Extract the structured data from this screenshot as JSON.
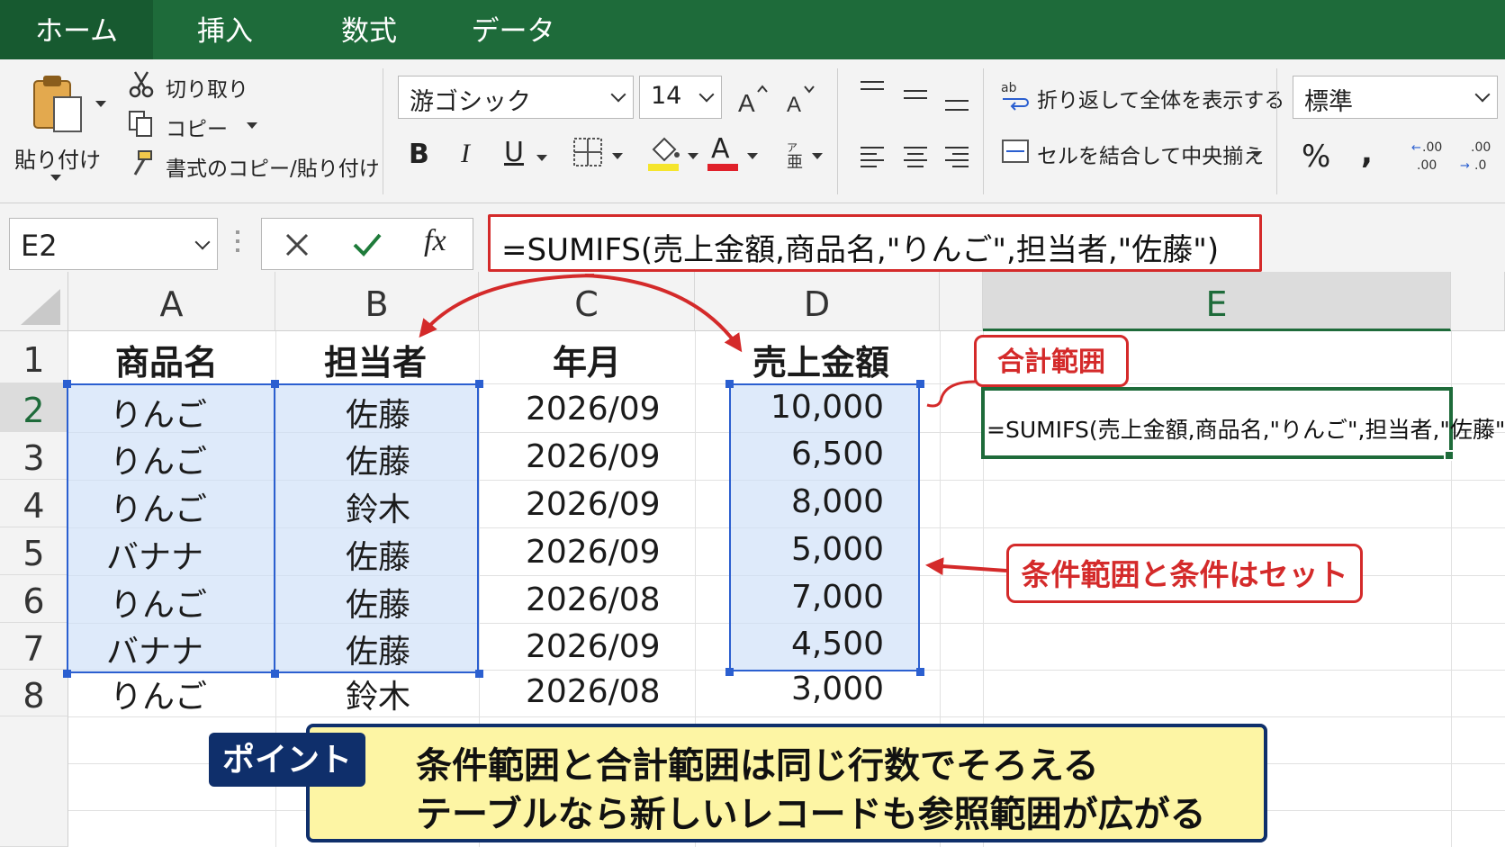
{
  "ribbon_tabs": [
    "ホーム",
    "挿入",
    "数式",
    "データ"
  ],
  "clipboard": {
    "paste_label": "貼り付け",
    "cut_label": "切り取り",
    "copy_label": "コピー",
    "format_painter_label": "書式のコピー/貼り付け"
  },
  "font": {
    "name": "游ゴシック",
    "size": "14",
    "bold_label": "B",
    "italic_label": "I",
    "underline_label": "U",
    "font_color_label": "A"
  },
  "alignment": {
    "wrap_text_label": "折り返して全体を表示する",
    "merge_center_label": "セルを結合して中央揃え"
  },
  "number": {
    "format": "標準",
    "percent_label": "%",
    "comma_label": ","
  },
  "formula_bar": {
    "name_box": "E2",
    "fx_label": "fx",
    "formula": "=SUMIFS(売上金額,商品名,\"りんご\",担当者,\"佐藤\")"
  },
  "sheet": {
    "columns": [
      "A",
      "B",
      "C",
      "D",
      "E"
    ],
    "selected_column": "E",
    "rows": [
      "1",
      "2",
      "3",
      "4",
      "5",
      "6",
      "7",
      "8"
    ],
    "selected_row": "2",
    "headers": [
      "商品名",
      "担当者",
      "年月",
      "売上金額"
    ],
    "data": [
      [
        "りんご",
        "佐藤",
        "2026/09",
        "10,000"
      ],
      [
        "りんご",
        "佐藤",
        "2026/09",
        "6,500"
      ],
      [
        "りんご",
        "鈴木",
        "2026/09",
        "8,000"
      ],
      [
        "バナナ",
        "佐藤",
        "2026/09",
        "5,000"
      ],
      [
        "りんご",
        "佐藤",
        "2026/08",
        "7,000"
      ],
      [
        "バナナ",
        "佐藤",
        "2026/09",
        "4,500"
      ],
      [
        "りんご",
        "鈴木",
        "2026/08",
        "3,000"
      ]
    ],
    "e2_formula": "=SUMIFS(売上金額,商品名,\"りんご\",担当者,\"佐藤\")"
  },
  "callouts": {
    "sum_range": "合計範囲",
    "criteria_pair": "条件範囲と条件はセット"
  },
  "point": {
    "label": "ポイント",
    "line1": "条件範囲と合計範囲は同じ行数でそろえる",
    "line2": "テーブルなら新しいレコードも参照範囲が広がる"
  },
  "colors": {
    "ribbon_green": "#1e6b3a",
    "selection_blue": "#2b5fd0",
    "callout_red": "#d42a2a",
    "point_navy": "#0f2f6b",
    "point_yellow": "#fdf5a4"
  }
}
